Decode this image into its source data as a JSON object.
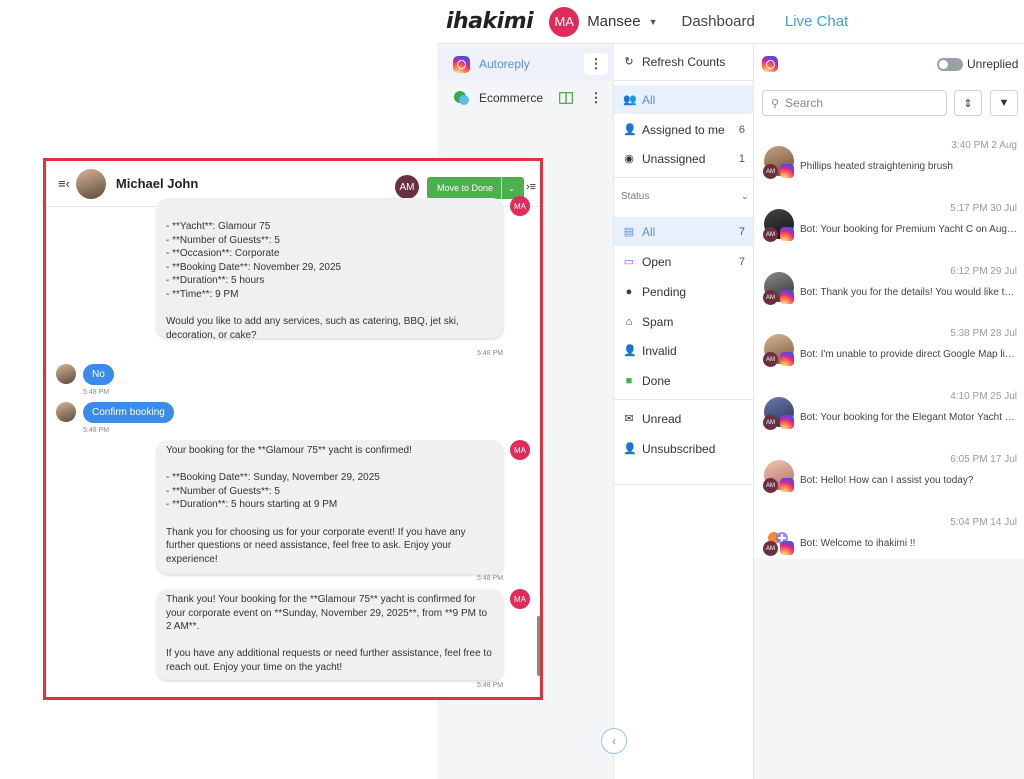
{
  "nav": {
    "logo": "ihakimi",
    "user_initials": "MA",
    "username": "Mansee",
    "dashboard": "Dashboard",
    "live_chat": "Live Chat"
  },
  "inboxes": [
    {
      "label": "Autoreply",
      "icon": "instagram-icon"
    },
    {
      "label": "Ecommerce",
      "icon": "chat-bubbles-icon"
    }
  ],
  "status_pane": {
    "refresh": "Refresh Counts",
    "all_top": "All",
    "assigned": {
      "label": "Assigned to me",
      "count": "6"
    },
    "unassigned": {
      "label": "Unassigned",
      "count": "1"
    },
    "status_header": "Status",
    "statuses": [
      {
        "label": "All",
        "count": "7",
        "icon": "document-icon"
      },
      {
        "label": "Open",
        "count": "7",
        "icon": "message-icon"
      },
      {
        "label": "Pending",
        "count": "",
        "icon": "alert-icon"
      },
      {
        "label": "Spam",
        "count": "",
        "icon": "spam-icon"
      },
      {
        "label": "Invalid",
        "count": "",
        "icon": "user-x-icon"
      },
      {
        "label": "Done",
        "count": "",
        "icon": "check-icon"
      }
    ],
    "unread": "Unread",
    "unsubscribed": "Unsubscribed"
  },
  "conv_list": {
    "unreplied": "Unreplied",
    "search_placeholder": "Search",
    "items": [
      {
        "time": "3:40 PM 2 Aug",
        "preview": "Phillips heated straightening brush",
        "agent": "AM"
      },
      {
        "time": "5:17 PM 30 Jul",
        "preview": "Bot: Your booking for Premium Yacht C on August...",
        "agent": "AM"
      },
      {
        "time": "6:12 PM 29 Jul",
        "preview": "Bot: Thank you for the details! You would like to b...",
        "agent": "AM"
      },
      {
        "time": "5:38 PM 28 Jul",
        "preview": "Bot: I'm unable to provide direct Google Map link...",
        "agent": "AM"
      },
      {
        "time": "4:10 PM 25 Jul",
        "preview": "Bot: Your booking for the Elegant Motor Yacht on ...",
        "agent": "AM"
      },
      {
        "time": "6:05 PM 17 Jul",
        "preview": "Bot: Hello! How can I assist you today?",
        "agent": "AM"
      },
      {
        "time": "5:04 PM 14 Jul",
        "preview": "Bot: Welcome to ihakimi !!",
        "agent": "AM"
      }
    ]
  },
  "chat": {
    "name": "Michael John",
    "agent_initials": "AM",
    "move_to_done": "Move to Done",
    "bot_initials": "MA",
    "msg1": "- **Yacht**: Glamour 75\n- **Number of Guests**: 5\n- **Occasion**: Corporate\n- **Booking Date**: November 29, 2025\n- **Duration**: 5 hours\n- **Time**: 9 PM\n\nWould you like to add any services, such as catering, BBQ, jet ski, decoration, or cake?",
    "time1": "5:48 PM",
    "user_msg1": "No",
    "time_u1": "5:48 PM",
    "user_msg2": "Confirm booking",
    "time_u2": "5:48 PM",
    "msg2": "Your booking for the **Glamour 75** yacht is confirmed!\n\n- **Booking Date**: Sunday, November 29, 2025\n- **Number of Guests**: 5\n- **Duration**: 5 hours starting at 9 PM\n\nThank you for choosing us for your corporate event! If you have any further questions or need assistance, feel free to ask. Enjoy your experience!",
    "time2": "5:48 PM",
    "msg3": "Thank you! Your booking for the **Glamour 75** yacht is confirmed for your corporate event on **Sunday, November 29, 2025**, from **9 PM to 2 AM**.\n\nIf you have any additional requests or need further assistance, feel free to reach out. Enjoy your time on the yacht!",
    "time3": "5:48 PM"
  }
}
